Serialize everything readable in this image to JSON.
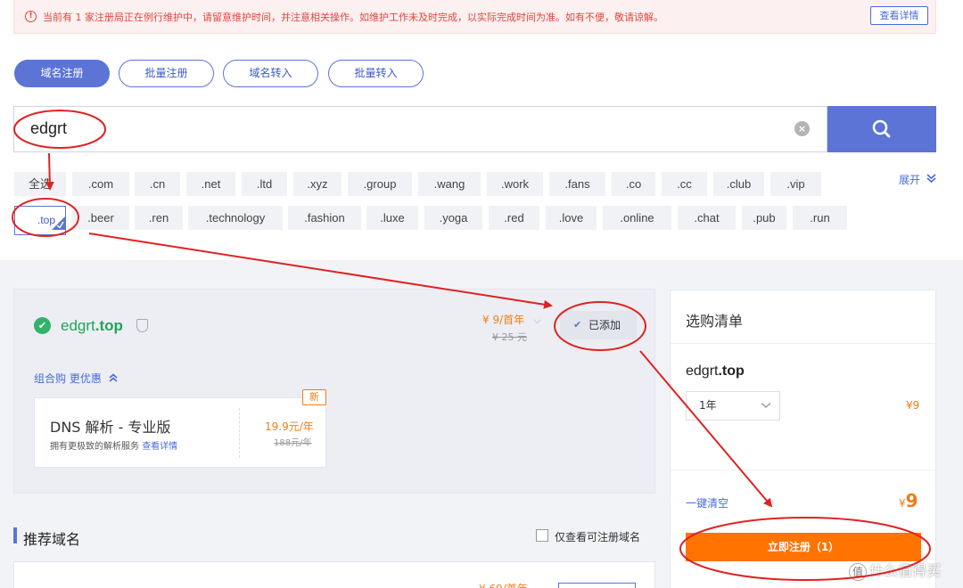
{
  "notice": {
    "icon": "info-circle-icon",
    "text": "当前有 1 家注册局正在例行维护中，请留意维护时间，并注意相关操作。如维护工作未及时完成，以实际完成时间为准。如有不便，敬请谅解。",
    "detail_button": "查看详情"
  },
  "mode_tabs": [
    "域名注册",
    "批量注册",
    "域名转入",
    "批量转入"
  ],
  "search": {
    "value": "edgrt",
    "clear_icon": "clear-icon",
    "search_icon": "search-icon"
  },
  "suffixes": {
    "row1": [
      "全选",
      ".com",
      ".cn",
      ".net",
      ".ltd",
      ".xyz",
      ".group",
      ".wang",
      ".work",
      ".fans",
      ".co",
      ".cc",
      ".club",
      ".vip"
    ],
    "row2": [
      ".top",
      ".beer",
      ".ren",
      ".technology",
      ".fashion",
      ".luxe",
      ".yoga",
      ".red",
      ".love",
      ".online",
      ".chat",
      ".pub",
      ".run"
    ],
    "selected": ".top",
    "expand_label": "展开"
  },
  "result": {
    "domain_name": "edgrt",
    "domain_suffix": ".top",
    "price": "¥ 9/首年",
    "old_price": "¥ 25 元",
    "added_label": "已添加",
    "combo_label": "组合购 更优惠",
    "dns": {
      "title": "DNS 解析 - 专业版",
      "desc": "拥有更极致的解析服务 ",
      "link": "查看详情",
      "price": "19.9元/年",
      "old_price": "188元/年",
      "badge": "新"
    }
  },
  "recommend": {
    "title": "推荐域名",
    "filter_label": "仅查看可注册域名",
    "partial_price": "¥ 69/首年"
  },
  "cart": {
    "title": "选购清单",
    "domain_name": "edgrt",
    "domain_suffix": ".top",
    "period": "1年",
    "item_price": "¥9",
    "clear_label": "一键清空",
    "total_symbol": "¥",
    "total_value": "9",
    "register_button": "立即注册（1）"
  },
  "watermark": {
    "logo_text": "值",
    "text": "什么值得买"
  },
  "colors": {
    "primary": "#5b74d6",
    "orange": "#ff7300",
    "success": "#34b26a",
    "annotation_red": "#e02222"
  }
}
